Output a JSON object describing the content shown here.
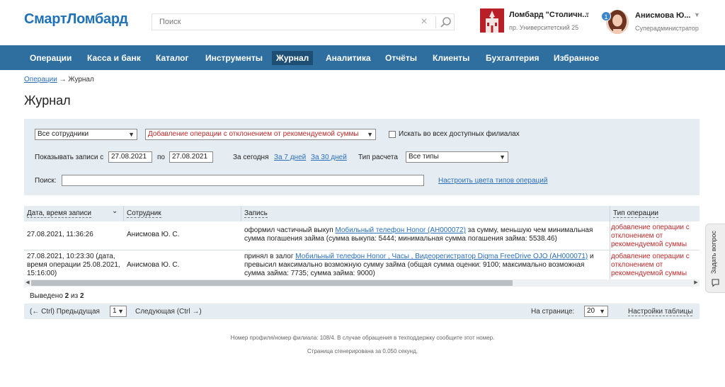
{
  "header": {
    "logo": "СмартЛомбард",
    "search_placeholder": "Поиск",
    "branch_name": "Ломбард \"Столичн...",
    "branch_address": "пр. Университетский 25",
    "notifications": "1",
    "user_name": "Анисмова Ю...",
    "user_role": "Суперадминистратор"
  },
  "nav": [
    {
      "label": "Операции"
    },
    {
      "label": "Касса и банк"
    },
    {
      "label": "Каталог"
    },
    {
      "label": "Инструменты"
    },
    {
      "label": "Журнал"
    },
    {
      "label": "Аналитика"
    },
    {
      "label": "Отчёты"
    },
    {
      "label": "Клиенты"
    },
    {
      "label": "Бухгалтерия"
    },
    {
      "label": "Избранное"
    }
  ],
  "breadcrumb": {
    "parent": "Операции",
    "arrow": "→",
    "current": "Журнал"
  },
  "page_title": "Журнал",
  "filters": {
    "employee_select": "Все сотрудники",
    "operation_select": "Добавление операции с отклонением от рекомендуемой суммы",
    "all_branches_label": "Искать во всех доступных филиалах",
    "show_from_label": "Показывать записи с",
    "date_from": "27.08.2021",
    "to_label": "по",
    "date_to": "27.08.2021",
    "today": "За сегодня",
    "week": "За 7 дней",
    "month": "За 30 дней",
    "calc_type_label": "Тип расчета",
    "calc_type_select": "Все типы",
    "search_label": "Поиск:",
    "colors_link": "Настроить цвета типов операций"
  },
  "table": {
    "headers": [
      "Дата, время записи",
      "Сотрудник",
      "Запись",
      "Тип операции"
    ],
    "sort_arrow": "⌄",
    "rows": [
      {
        "date": "27.08.2021, 11:36:26",
        "employee": "Анисмова Ю. С.",
        "record_pre": "оформил частичный выкуп ",
        "record_link": "Мобильный телефон Honor (АН000072)",
        "record_post": " за сумму, меньшую чем минимальная сумма погашения займа (сумма выкупа: 5444; минимальная сумма погашения займа: 5538.46)",
        "type": "добавление операции с отклонением от рекомендуемой суммы"
      },
      {
        "date": "27.08.2021, 10:23:30 (дата, время операции 25.08.2021, 15:16:00)",
        "employee": "Анисмова Ю. С.",
        "record_pre": "принял в залог ",
        "record_link": "Мобильный телефон Honor , Часы , Видеорегистратор Digma FreeDrive OJO (АН000071)",
        "record_post": " и превысил максимально возможную сумму займа (общая сумма оценки: 9100; максимально возможная сумма займа: 7735; сумма займа: 9000)",
        "type": "добавление операции с отклонением от рекомендуемой суммы"
      }
    ]
  },
  "summary": {
    "prefix": "Выведено ",
    "shown": "2",
    "middle": " из ",
    "total": "2"
  },
  "pager": {
    "prev": "(← Ctrl) Предыдущая",
    "page": "1",
    "next": "Следующая (Ctrl →)",
    "per_page_label": "На странице:",
    "per_page": "20",
    "settings": "Настройки таблицы"
  },
  "footer": {
    "line1": "Номер профиля/номер филиала: 108/4. В случае обращения в техподдержку сообщите этот номер.",
    "line2": "Страница сгенерирована за 0.050 секунд."
  },
  "help_tab": "Задать вопрос",
  "colors": {
    "nav_bg": "#2f6f9f",
    "nav_active": "#1e4e74",
    "link": "#2a6ebb",
    "operation_type": "#c0292a",
    "filter_bg": "#e6edf2"
  }
}
